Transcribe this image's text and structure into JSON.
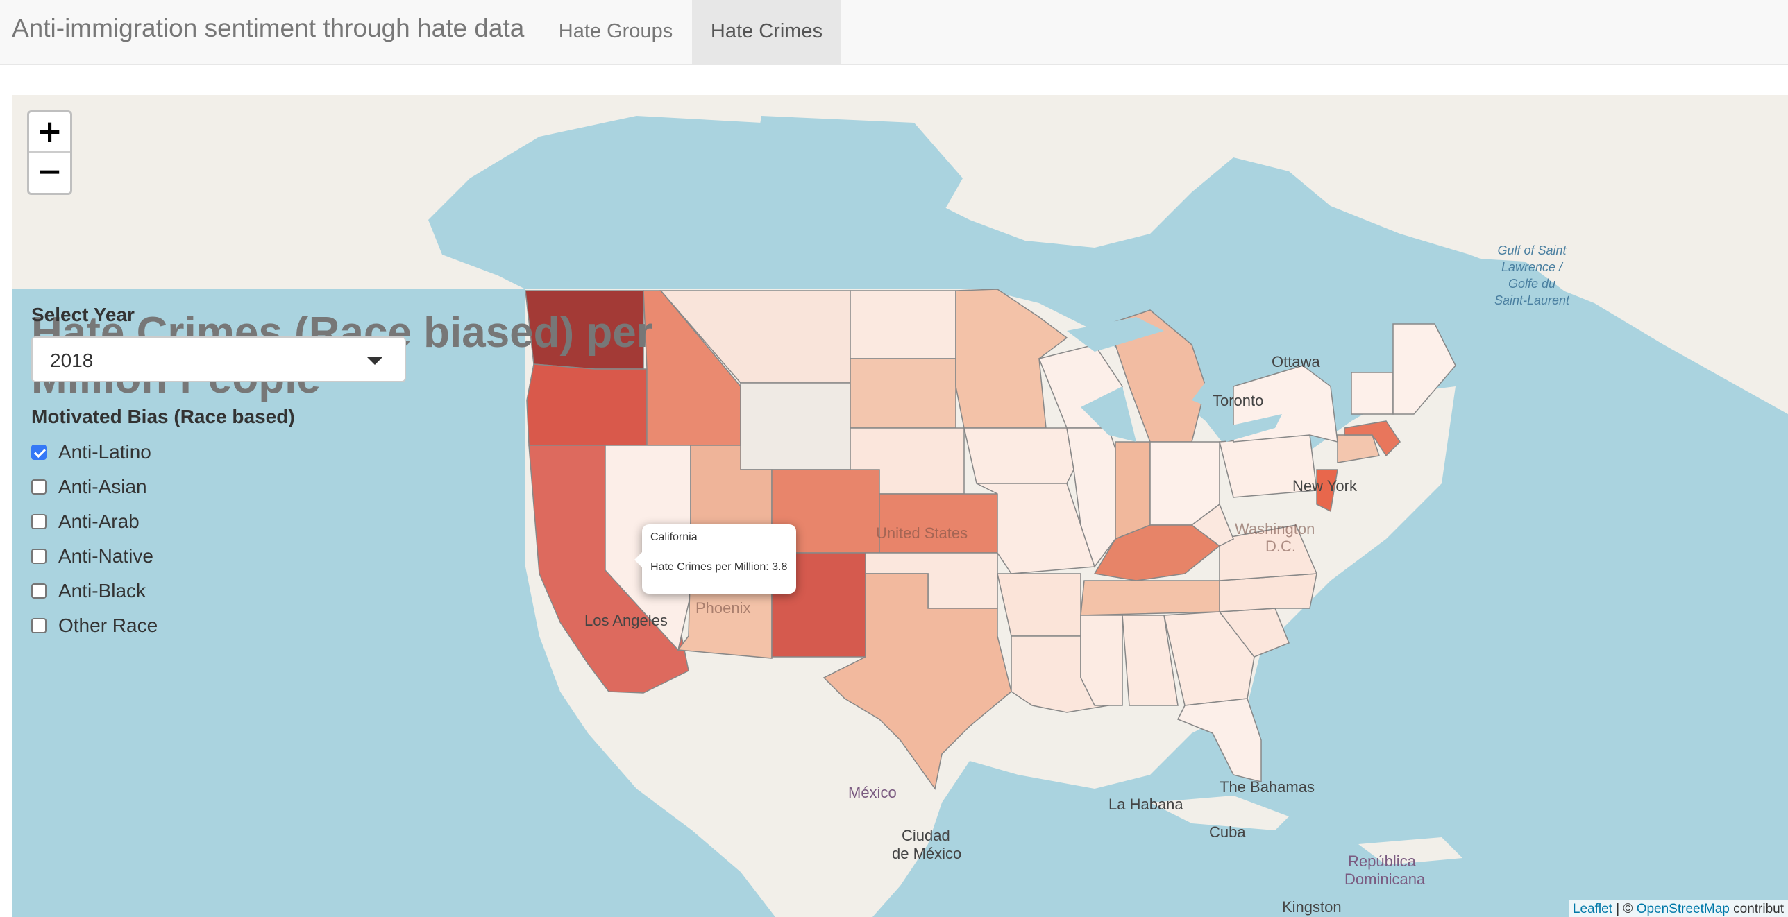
{
  "navbar": {
    "brand": "Anti-immigration sentiment through hate data",
    "tabs": [
      {
        "label": "Hate Groups",
        "active": false
      },
      {
        "label": "Hate Crimes",
        "active": true
      }
    ]
  },
  "map": {
    "zoom_in": "+",
    "zoom_out": "−",
    "title": "Hate Crimes (Race biased) per Million People",
    "labels": {
      "ottawa": "Ottawa",
      "toronto": "Toronto",
      "new_york": "New York",
      "washington": "Washington",
      "dc": "D.C.",
      "united_states": "United States",
      "phoenix": "Phoenix",
      "los_angeles": "Los Angeles",
      "mexico": "México",
      "ciudad": "Ciudad",
      "de_mexico": "de México",
      "la_habana": "La Habana",
      "cuba": "Cuba",
      "bahamas": "The Bahamas",
      "republica": "República",
      "dominicana": "Dominicana",
      "kingston": "Kingston",
      "gulf": "Gulf of Saint Lawrence / Golfe du Saint-Laurent"
    },
    "popup": {
      "state": "California",
      "value_text": "Hate Crimes per Million: 3.8"
    },
    "attribution": {
      "leaflet": "Leaflet",
      "sep": " | © ",
      "osm": "OpenStreetMap",
      "suffix": " contribut"
    },
    "colors": {
      "water": "#aad3df",
      "land": "#f2efe9",
      "state_border": "#888888"
    }
  },
  "controls": {
    "year_label": "Select Year",
    "year_value": "2018",
    "bias_label": "Motivated Bias (Race based)",
    "bias_options": [
      {
        "label": "Anti-Latino",
        "checked": true
      },
      {
        "label": "Anti-Asian",
        "checked": false
      },
      {
        "label": "Anti-Arab",
        "checked": false
      },
      {
        "label": "Anti-Native",
        "checked": false
      },
      {
        "label": "Anti-Black",
        "checked": false
      },
      {
        "label": "Other Race",
        "checked": false
      }
    ]
  }
}
